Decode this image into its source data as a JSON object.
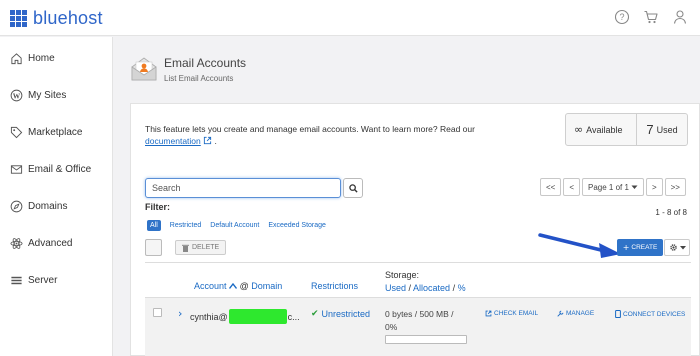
{
  "brand": {
    "logo_text": "bluehost",
    "color": "#2f66c9"
  },
  "topbar": {
    "icons": [
      "help-icon",
      "cart-icon",
      "user-icon"
    ]
  },
  "sidebar": {
    "items": [
      {
        "label": "Home",
        "icon": "home-icon"
      },
      {
        "label": "My Sites",
        "icon": "wordpress-icon"
      },
      {
        "label": "Marketplace",
        "icon": "tag-icon"
      },
      {
        "label": "Email & Office",
        "icon": "envelope-icon"
      },
      {
        "label": "Domains",
        "icon": "compass-icon"
      },
      {
        "label": "Advanced",
        "icon": "atom-icon"
      },
      {
        "label": "Server",
        "icon": "server-icon"
      }
    ]
  },
  "page": {
    "title": "Email Accounts",
    "subtitle": "List Email Accounts"
  },
  "info": {
    "text": "This feature lets you create and manage email accounts. Want to learn more? Read our",
    "link": "documentation",
    "after": "."
  },
  "usage": {
    "available_symbol": "∞",
    "available_label": "Available",
    "used_count": "7",
    "used_label": "Used"
  },
  "search": {
    "placeholder": "Search"
  },
  "pagination": {
    "first": "<<",
    "prev": "<",
    "page_label": "Page 1 of 1",
    "next": ">",
    "last": ">>",
    "count": "1 - 8 of 8"
  },
  "filter": {
    "label": "Filter:",
    "options": [
      "All",
      "Restricted",
      "Default Account",
      "Exceeded Storage"
    ],
    "active": "All"
  },
  "toolbar": {
    "delete_label": "DELETE",
    "create_label": "CREATE",
    "accent": "#2f73c8"
  },
  "table": {
    "headers": {
      "account": "Account",
      "at": "@",
      "domain": "Domain",
      "restrictions": "Restrictions",
      "storage": "Storage:",
      "used": "Used",
      "allocated": "Allocated",
      "percent": "%"
    },
    "rows": [
      {
        "account_prefix": "cynthia@",
        "account_suffix": "c...",
        "restrictions": "Unrestricted",
        "storage_line": "0 bytes / 500 MB /",
        "percent": "0%",
        "percent_value": 0,
        "actions": [
          "CHECK EMAIL",
          "MANAGE",
          "CONNECT DEVICES"
        ]
      }
    ]
  }
}
